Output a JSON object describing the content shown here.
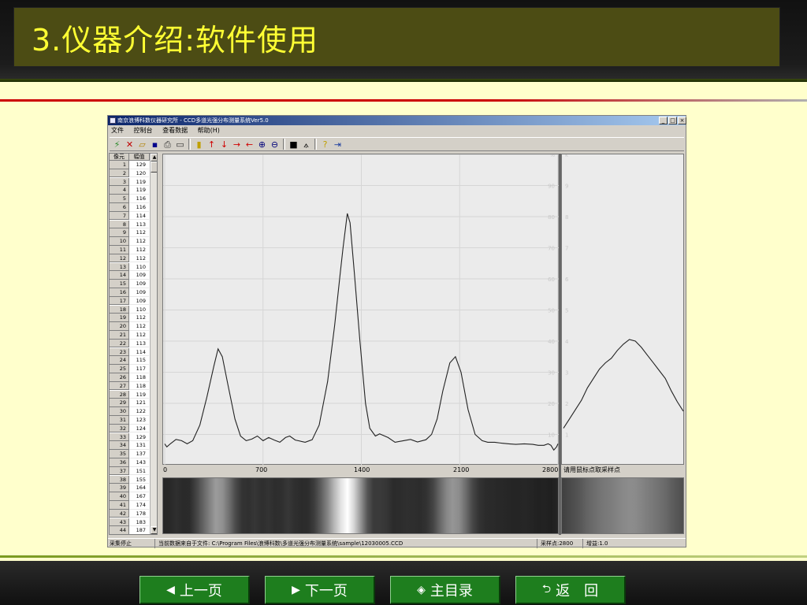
{
  "slide": {
    "title": "3.仪器介绍:软件使用",
    "nav": {
      "prev": "上一页",
      "next": "下一页",
      "toc": "主目录",
      "back": "返　回"
    }
  },
  "app": {
    "window_title": "南京浪博科数仪器研究所 - CCD多道光强分布测量系统Ver5.0",
    "caption_buttons": [
      "_",
      "□",
      "×"
    ],
    "menu": [
      "文件",
      "控制台",
      "查看数据",
      "帮助(H)"
    ],
    "toolbar_icons": [
      "sample-icon",
      "delete-icon",
      "open-icon",
      "save-icon",
      "print-icon",
      "preview-icon",
      "marker-icon",
      "arrow-up-icon",
      "arrow-down-icon",
      "arrow-right-icon",
      "arrow-left-icon",
      "zoom-in-icon",
      "zoom-out-icon",
      "rect-icon",
      "measure-icon",
      "help-icon",
      "exit-icon"
    ],
    "table": {
      "headers": [
        "像元",
        "幅值"
      ],
      "rows": [
        [
          "1",
          "129"
        ],
        [
          "2",
          "120"
        ],
        [
          "3",
          "119"
        ],
        [
          "4",
          "119"
        ],
        [
          "5",
          "116"
        ],
        [
          "6",
          "116"
        ],
        [
          "7",
          "114"
        ],
        [
          "8",
          "113"
        ],
        [
          "9",
          "112"
        ],
        [
          "10",
          "112"
        ],
        [
          "11",
          "112"
        ],
        [
          "12",
          "112"
        ],
        [
          "13",
          "110"
        ],
        [
          "14",
          "109"
        ],
        [
          "15",
          "109"
        ],
        [
          "16",
          "109"
        ],
        [
          "17",
          "109"
        ],
        [
          "18",
          "110"
        ],
        [
          "19",
          "112"
        ],
        [
          "20",
          "112"
        ],
        [
          "21",
          "112"
        ],
        [
          "22",
          "113"
        ],
        [
          "23",
          "114"
        ],
        [
          "24",
          "115"
        ],
        [
          "25",
          "117"
        ],
        [
          "26",
          "118"
        ],
        [
          "27",
          "118"
        ],
        [
          "28",
          "119"
        ],
        [
          "29",
          "121"
        ],
        [
          "30",
          "122"
        ],
        [
          "31",
          "123"
        ],
        [
          "32",
          "124"
        ],
        [
          "33",
          "129"
        ],
        [
          "34",
          "131"
        ],
        [
          "35",
          "137"
        ],
        [
          "36",
          "143"
        ],
        [
          "37",
          "151"
        ],
        [
          "38",
          "155"
        ],
        [
          "39",
          "164"
        ],
        [
          "40",
          "167"
        ],
        [
          "41",
          "174"
        ],
        [
          "42",
          "178"
        ],
        [
          "43",
          "183"
        ],
        [
          "44",
          "187"
        ]
      ]
    },
    "main_plot": {
      "x_ticks": [
        "0",
        "700",
        "1400",
        "2100",
        "2800"
      ],
      "x_tick_values": [
        0,
        700,
        1400,
        2100,
        2800
      ],
      "x_range": [
        0,
        2800
      ],
      "y_ticks": [
        "10",
        "20",
        "30",
        "40",
        "50",
        "60",
        "70",
        "80",
        "90",
        "%"
      ],
      "y_tick_values": [
        10,
        20,
        30,
        40,
        50,
        60,
        70,
        80,
        90,
        100
      ],
      "y_range": [
        0,
        100
      ],
      "curve": [
        [
          0,
          7
        ],
        [
          15,
          6
        ],
        [
          40,
          7
        ],
        [
          80,
          8.4
        ],
        [
          120,
          8
        ],
        [
          160,
          7
        ],
        [
          200,
          8
        ],
        [
          250,
          13
        ],
        [
          300,
          22
        ],
        [
          350,
          32
        ],
        [
          380,
          37.5
        ],
        [
          410,
          35
        ],
        [
          450,
          26
        ],
        [
          500,
          15
        ],
        [
          540,
          9.5
        ],
        [
          580,
          8
        ],
        [
          620,
          8.5
        ],
        [
          660,
          9.5
        ],
        [
          700,
          8
        ],
        [
          740,
          9
        ],
        [
          780,
          8.2
        ],
        [
          820,
          7.5
        ],
        [
          860,
          9
        ],
        [
          890,
          9.5
        ],
        [
          930,
          8.2
        ],
        [
          1000,
          7.5
        ],
        [
          1050,
          8.3
        ],
        [
          1100,
          13
        ],
        [
          1160,
          27
        ],
        [
          1210,
          45
        ],
        [
          1250,
          62
        ],
        [
          1270,
          70
        ],
        [
          1300,
          81
        ],
        [
          1320,
          78
        ],
        [
          1350,
          62
        ],
        [
          1390,
          40
        ],
        [
          1430,
          20
        ],
        [
          1460,
          12
        ],
        [
          1500,
          9.5
        ],
        [
          1530,
          10.2
        ],
        [
          1550,
          9.8
        ],
        [
          1590,
          9
        ],
        [
          1640,
          7.5
        ],
        [
          1700,
          8
        ],
        [
          1750,
          8.4
        ],
        [
          1800,
          7.6
        ],
        [
          1860,
          8.3
        ],
        [
          1900,
          10
        ],
        [
          1940,
          15
        ],
        [
          1980,
          24
        ],
        [
          2030,
          33
        ],
        [
          2070,
          35
        ],
        [
          2110,
          30
        ],
        [
          2160,
          18
        ],
        [
          2210,
          10
        ],
        [
          2260,
          8
        ],
        [
          2300,
          7.5
        ],
        [
          2350,
          7.5
        ],
        [
          2400,
          7.2
        ],
        [
          2450,
          7
        ],
        [
          2500,
          6.8
        ],
        [
          2560,
          7
        ],
        [
          2620,
          6.8
        ],
        [
          2660,
          6.5
        ],
        [
          2700,
          6.5
        ],
        [
          2730,
          7
        ],
        [
          2750,
          6.5
        ],
        [
          2770,
          5
        ],
        [
          2790,
          6
        ],
        [
          2800,
          7
        ]
      ]
    },
    "side_plot": {
      "y_ticks": [
        "1",
        "2",
        "3",
        "4",
        "5",
        "6",
        "7",
        "8",
        "9",
        "k"
      ],
      "y_tick_values": [
        1,
        2,
        3,
        4,
        5,
        6,
        7,
        8,
        9,
        10
      ],
      "y_range": [
        0,
        10
      ],
      "curve": [
        [
          0,
          1.2
        ],
        [
          0.05,
          1.5
        ],
        [
          0.1,
          1.8
        ],
        [
          0.15,
          2.1
        ],
        [
          0.2,
          2.5
        ],
        [
          0.25,
          2.8
        ],
        [
          0.3,
          3.1
        ],
        [
          0.35,
          3.3
        ],
        [
          0.4,
          3.45
        ],
        [
          0.45,
          3.7
        ],
        [
          0.5,
          3.9
        ],
        [
          0.55,
          4.05
        ],
        [
          0.6,
          4.0
        ],
        [
          0.65,
          3.8
        ],
        [
          0.7,
          3.55
        ],
        [
          0.75,
          3.3
        ],
        [
          0.8,
          3.05
        ],
        [
          0.85,
          2.8
        ],
        [
          0.9,
          2.4
        ],
        [
          0.95,
          2.05
        ],
        [
          1.0,
          1.75
        ]
      ],
      "hint": "请用鼠标点取采样点"
    },
    "status": {
      "state": "采集停止",
      "file": "当前数据来自于文件: C:\\Program Files\\浪博科数\\多道光强分布测量系统\\sample\\12030005.CCD",
      "sample_points": "采样点:2800",
      "gain": "增益:1.0"
    }
  }
}
